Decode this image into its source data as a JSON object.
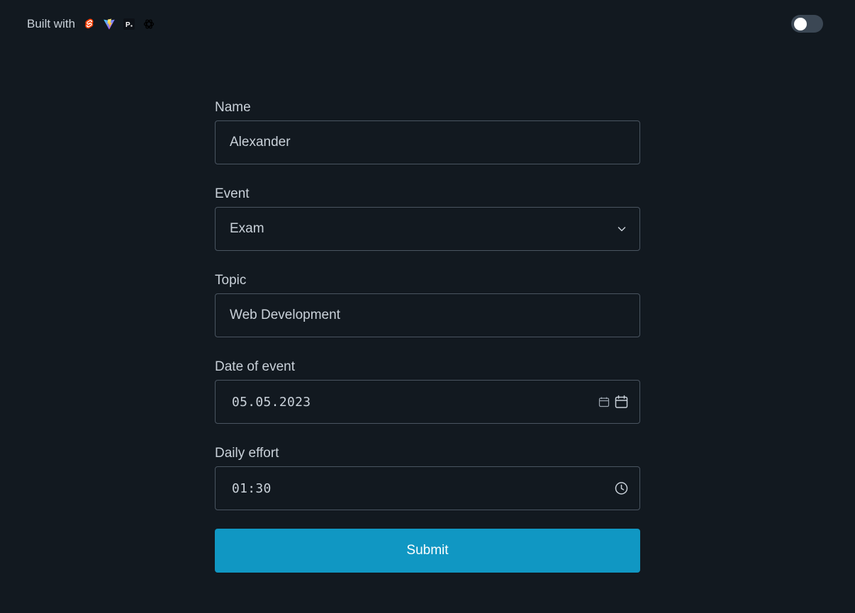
{
  "header": {
    "built_with_label": "Built with",
    "logos": [
      {
        "name": "svelte-logo-icon",
        "color": "#ff3e00"
      },
      {
        "name": "vite-logo-icon",
        "color": "#a855f7"
      },
      {
        "name": "pico-logo-icon",
        "color": "#ffffff"
      },
      {
        "name": "openai-logo-icon",
        "color": "#000000"
      }
    ],
    "theme_toggle": {
      "state": "off"
    }
  },
  "form": {
    "name": {
      "label": "Name",
      "value": "Alexander"
    },
    "event": {
      "label": "Event",
      "value": "Exam"
    },
    "topic": {
      "label": "Topic",
      "value": "Web Development"
    },
    "date": {
      "label": "Date of event",
      "value": "05.05.2023"
    },
    "effort": {
      "label": "Daily effort",
      "value": "01:30"
    },
    "submit_label": "Submit"
  },
  "colors": {
    "background": "#121920",
    "border": "#4a5561",
    "text": "#c9d1d9",
    "primary": "#1097c3",
    "toggle_track": "#3b4754"
  }
}
